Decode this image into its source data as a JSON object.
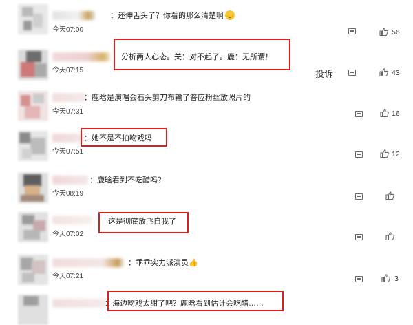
{
  "comments": [
    {
      "text": "还伸舌头了？你看的那么清楚啊",
      "time": "今天07:00",
      "likes": "56",
      "emoji": "smile-emoji"
    },
    {
      "text": "分析两人心态。关：对不起了。鹿：无所谓！",
      "time": "今天07:15",
      "likes": "43"
    },
    {
      "text": "鹿晗是演唱会石头剪刀布输了答应粉丝放照片的",
      "time": "今天07:31",
      "likes": "16"
    },
    {
      "text": "她不是不拍吻戏吗",
      "time": "今天07:51",
      "likes": "12"
    },
    {
      "text": "鹿晗看到不吃醋吗？",
      "time": "今天08:19",
      "likes": ""
    },
    {
      "text": "这是彻底放飞自我了",
      "time": "今天07:02",
      "likes": ""
    },
    {
      "text": "乖乖实力派演员",
      "time": "今天07:21",
      "likes": "3",
      "emoji": "thumbs-up-emoji"
    },
    {
      "text": "海边吻戏太甜了吧？鹿晗看到估计会吃醋……",
      "time": "",
      "likes": ""
    }
  ],
  "report_label": "投诉",
  "colon": "：",
  "colors": {
    "highlight": "#d8211d",
    "text": "#222222",
    "icon": "#666666"
  }
}
